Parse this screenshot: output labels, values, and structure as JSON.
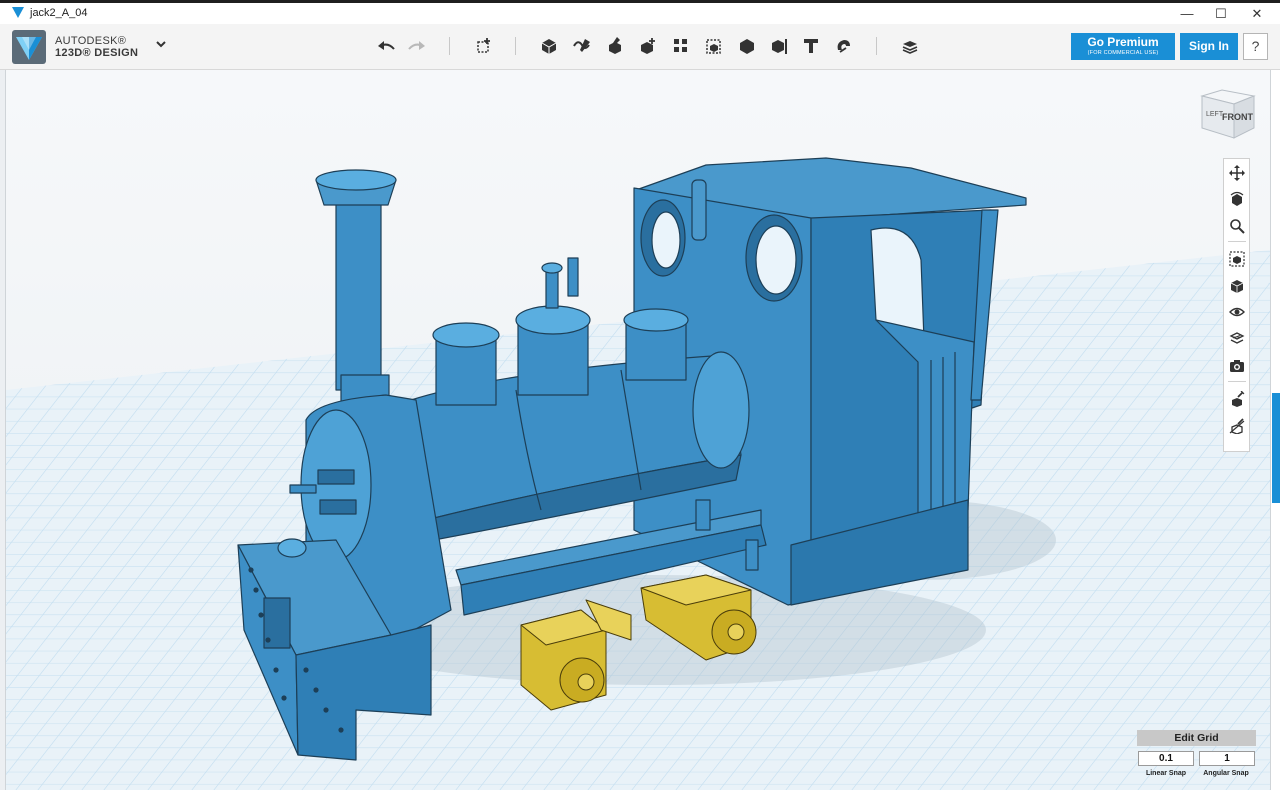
{
  "window": {
    "title": "jack2_A_04",
    "minimize": "—",
    "maximize": "☐",
    "close": "✕"
  },
  "brand": {
    "line1": "AUTODESK®",
    "line2": "123D® DESIGN"
  },
  "toolbar": {
    "tools": [
      "undo-icon",
      "redo-icon",
      "transform-icon",
      "primitives-icon",
      "sketch-icon",
      "construct-icon",
      "modify-icon",
      "pattern-icon",
      "grouping-icon",
      "combine-icon",
      "measure-icon",
      "text-icon",
      "snap-icon",
      "material-icon"
    ]
  },
  "account": {
    "premium_label": "Go Premium",
    "premium_sub": "(FOR COMMERCIAL USE)",
    "signin_label": "Sign In",
    "help_label": "?"
  },
  "viewcube": {
    "left": "LEFT",
    "front": "FRONT"
  },
  "grid": {
    "edit_label": "Edit Grid",
    "linear_value": "0.1",
    "angular_value": "1",
    "linear_label": "Linear Snap",
    "angular_label": "Angular Snap"
  },
  "colors": {
    "accent": "#1a8fd6",
    "model": "#3d8fc6",
    "parts": "#d7bd33",
    "grid": "#bfdbee"
  }
}
